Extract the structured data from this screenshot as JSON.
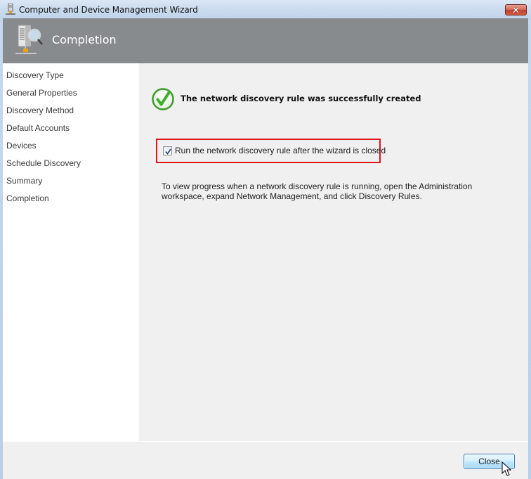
{
  "window": {
    "title": "Computer and Device Management Wizard",
    "close_glyph": "✕"
  },
  "header": {
    "title": "Completion",
    "icon": "network-discovery-server-icon"
  },
  "sidebar": {
    "items": [
      {
        "label": "Discovery Type"
      },
      {
        "label": "General Properties"
      },
      {
        "label": "Discovery Method"
      },
      {
        "label": "Default Accounts"
      },
      {
        "label": "Devices"
      },
      {
        "label": "Schedule Discovery"
      },
      {
        "label": "Summary"
      },
      {
        "label": "Completion"
      }
    ],
    "active_index": 7
  },
  "content": {
    "success_message": "The network discovery rule was successfully created",
    "success_icon": "green-checkmark-icon",
    "run_rule_checkbox": {
      "label": "Run the network discovery rule after the wizard is closed",
      "checked": true
    },
    "info_text": "To view progress when a network discovery rule is running, open the Administration workspace, expand Network Management, and click Discovery Rules.",
    "highlight_color": "#d9191b"
  },
  "footer": {
    "close_label": "Close"
  }
}
